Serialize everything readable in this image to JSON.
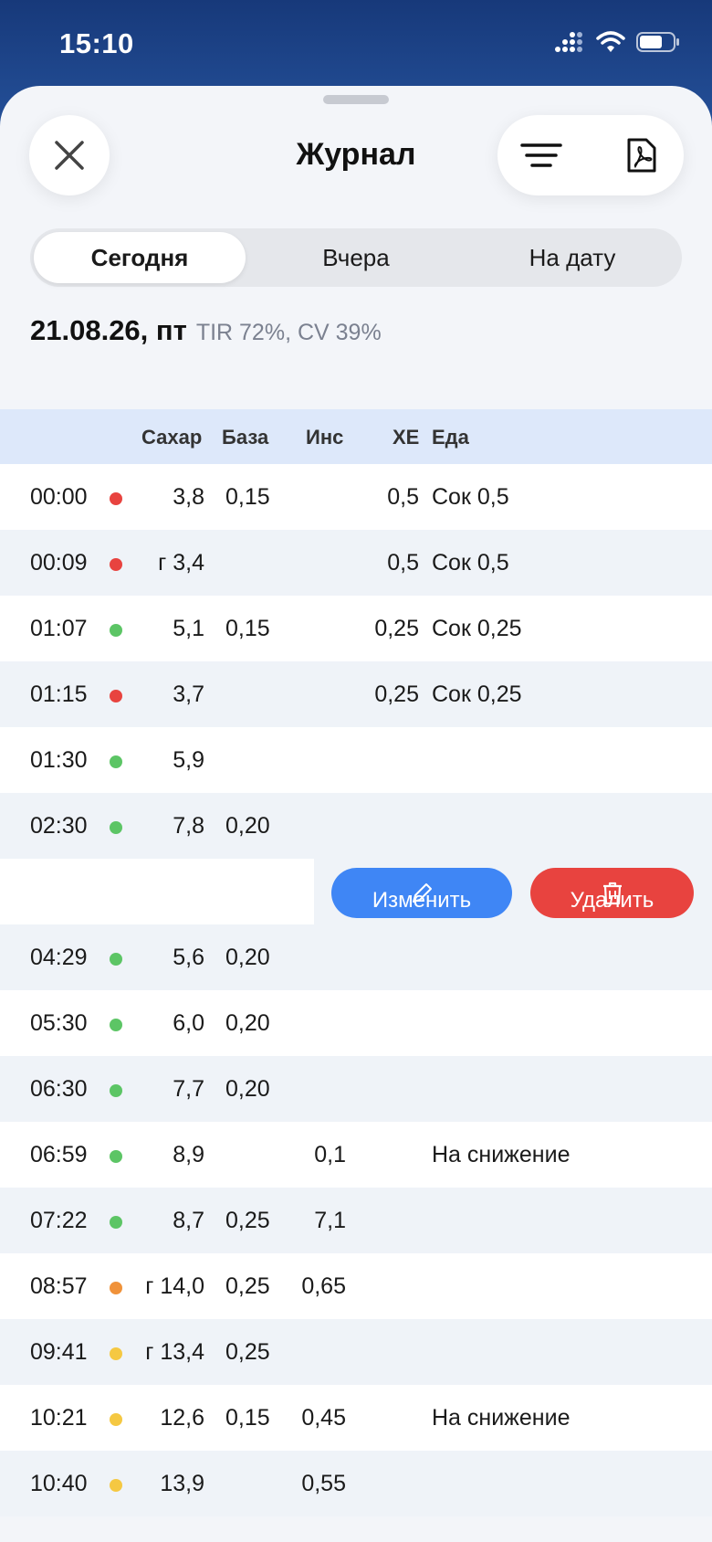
{
  "status": {
    "time": "15:10"
  },
  "header": {
    "title": "Журнал"
  },
  "tabs": [
    {
      "label": "Сегодня",
      "active": true
    },
    {
      "label": "Вчера",
      "active": false
    },
    {
      "label": "На дату",
      "active": false
    }
  ],
  "day": {
    "date": "21.08.26, пт",
    "stats": "TIR 72%, CV 39%"
  },
  "columns": {
    "sugar": "Сахар",
    "basal": "База",
    "ins": "Инс",
    "xe": "ХЕ",
    "food": "Еда"
  },
  "colors": {
    "red": "#e8433f",
    "green": "#5cc565",
    "orange": "#f0923a",
    "yellow": "#f5c842",
    "accent": "#3f86f5"
  },
  "actions": {
    "edit": "Изменить",
    "delete": "Удалить"
  },
  "rows": [
    {
      "time": "00:00",
      "dot": "red",
      "sugar": "3,8",
      "basal": "0,15",
      "ins": "",
      "xe": "0,5",
      "food": "Сок 0,5"
    },
    {
      "time": "00:09",
      "dot": "red",
      "sugar": "г 3,4",
      "basal": "",
      "ins": "",
      "xe": "0,5",
      "food": "Сок 0,5"
    },
    {
      "time": "01:07",
      "dot": "green",
      "sugar": "5,1",
      "basal": "0,15",
      "ins": "",
      "xe": "0,25",
      "food": "Сок 0,25"
    },
    {
      "time": "01:15",
      "dot": "red",
      "sugar": "3,7",
      "basal": "",
      "ins": "",
      "xe": "0,25",
      "food": "Сок 0,25"
    },
    {
      "time": "01:30",
      "dot": "green",
      "sugar": "5,9",
      "basal": "",
      "ins": "",
      "xe": "",
      "food": ""
    },
    {
      "time": "02:30",
      "dot": "green",
      "sugar": "7,8",
      "basal": "0,20",
      "ins": "",
      "xe": "",
      "food": ""
    },
    {
      "swipe": true
    },
    {
      "time": "04:29",
      "dot": "green",
      "sugar": "5,6",
      "basal": "0,20",
      "ins": "",
      "xe": "",
      "food": ""
    },
    {
      "time": "05:30",
      "dot": "green",
      "sugar": "6,0",
      "basal": "0,20",
      "ins": "",
      "xe": "",
      "food": ""
    },
    {
      "time": "06:30",
      "dot": "green",
      "sugar": "7,7",
      "basal": "0,20",
      "ins": "",
      "xe": "",
      "food": ""
    },
    {
      "time": "06:59",
      "dot": "green",
      "sugar": "8,9",
      "basal": "",
      "ins": "0,1",
      "xe": "",
      "food": "На снижение"
    },
    {
      "time": "07:22",
      "dot": "green",
      "sugar": "8,7",
      "basal": "0,25",
      "ins": "7,1",
      "xe": "",
      "food": ""
    },
    {
      "time": "08:57",
      "dot": "orange",
      "sugar": "г 14,0",
      "basal": "0,25",
      "ins": "0,65",
      "xe": "",
      "food": ""
    },
    {
      "time": "09:41",
      "dot": "yellow",
      "sugar": "г 13,4",
      "basal": "0,25",
      "ins": "",
      "xe": "",
      "food": ""
    },
    {
      "time": "10:21",
      "dot": "yellow",
      "sugar": "12,6",
      "basal": "0,15",
      "ins": "0,45",
      "xe": "",
      "food": "На снижение"
    },
    {
      "time": "10:40",
      "dot": "yellow",
      "sugar": "13,9",
      "basal": "",
      "ins": "0,55",
      "xe": "",
      "food": ""
    }
  ]
}
